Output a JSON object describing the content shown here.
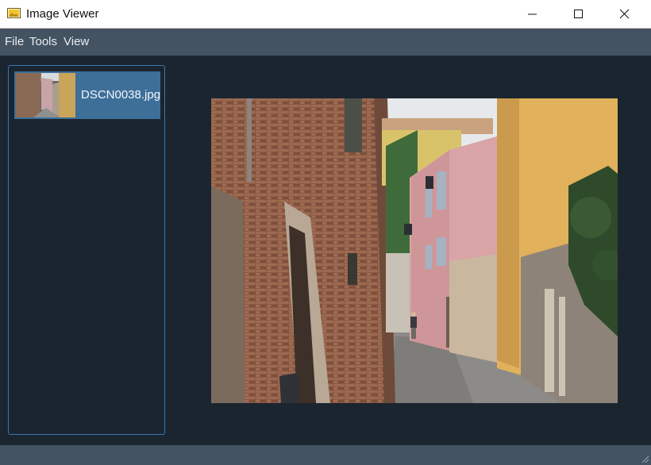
{
  "window": {
    "title": "Image Viewer"
  },
  "menu": [
    "File",
    "Tools",
    "View"
  ],
  "sidebar": {
    "items": [
      {
        "label": "DSCN0038.jpg",
        "selected": true
      }
    ]
  },
  "colors": {
    "menubar": "#445362",
    "background": "#1b2530",
    "selection": "#3d6f98",
    "sidebar_border": "#3b78b3"
  },
  "icons": {
    "app": "image-icon",
    "minimize": "minimize-icon",
    "maximize": "maximize-icon",
    "close": "close-icon",
    "resize": "resize-grip-icon"
  }
}
